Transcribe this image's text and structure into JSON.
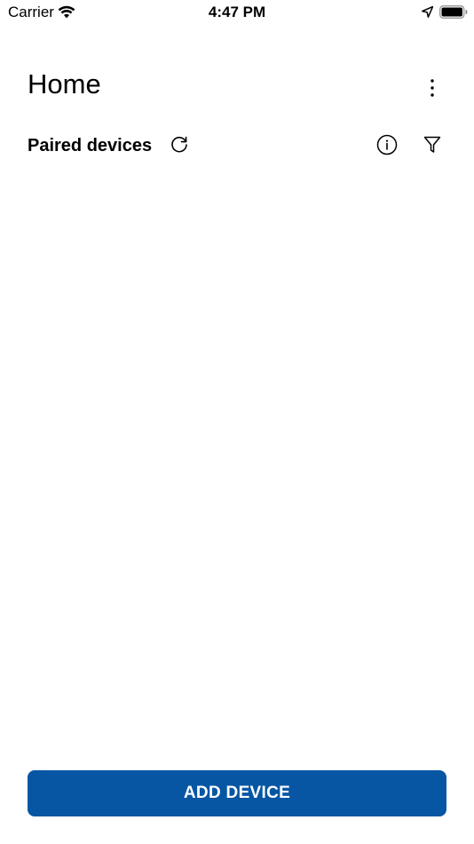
{
  "status_bar": {
    "carrier": "Carrier",
    "time": "4:47 PM",
    "icons": [
      "wifi-icon",
      "location-arrow-icon",
      "battery-icon"
    ]
  },
  "header": {
    "title": "Home",
    "menu_icon": "more-vertical-icon"
  },
  "section": {
    "title": "Paired devices",
    "actions": [
      "refresh-icon",
      "info-icon",
      "filter-icon"
    ]
  },
  "device_list": {
    "items": []
  },
  "footer": {
    "add_device_label": "ADD DEVICE"
  },
  "colors": {
    "primary": "#0656a4",
    "background": "#ffffff",
    "text": "#000000"
  }
}
